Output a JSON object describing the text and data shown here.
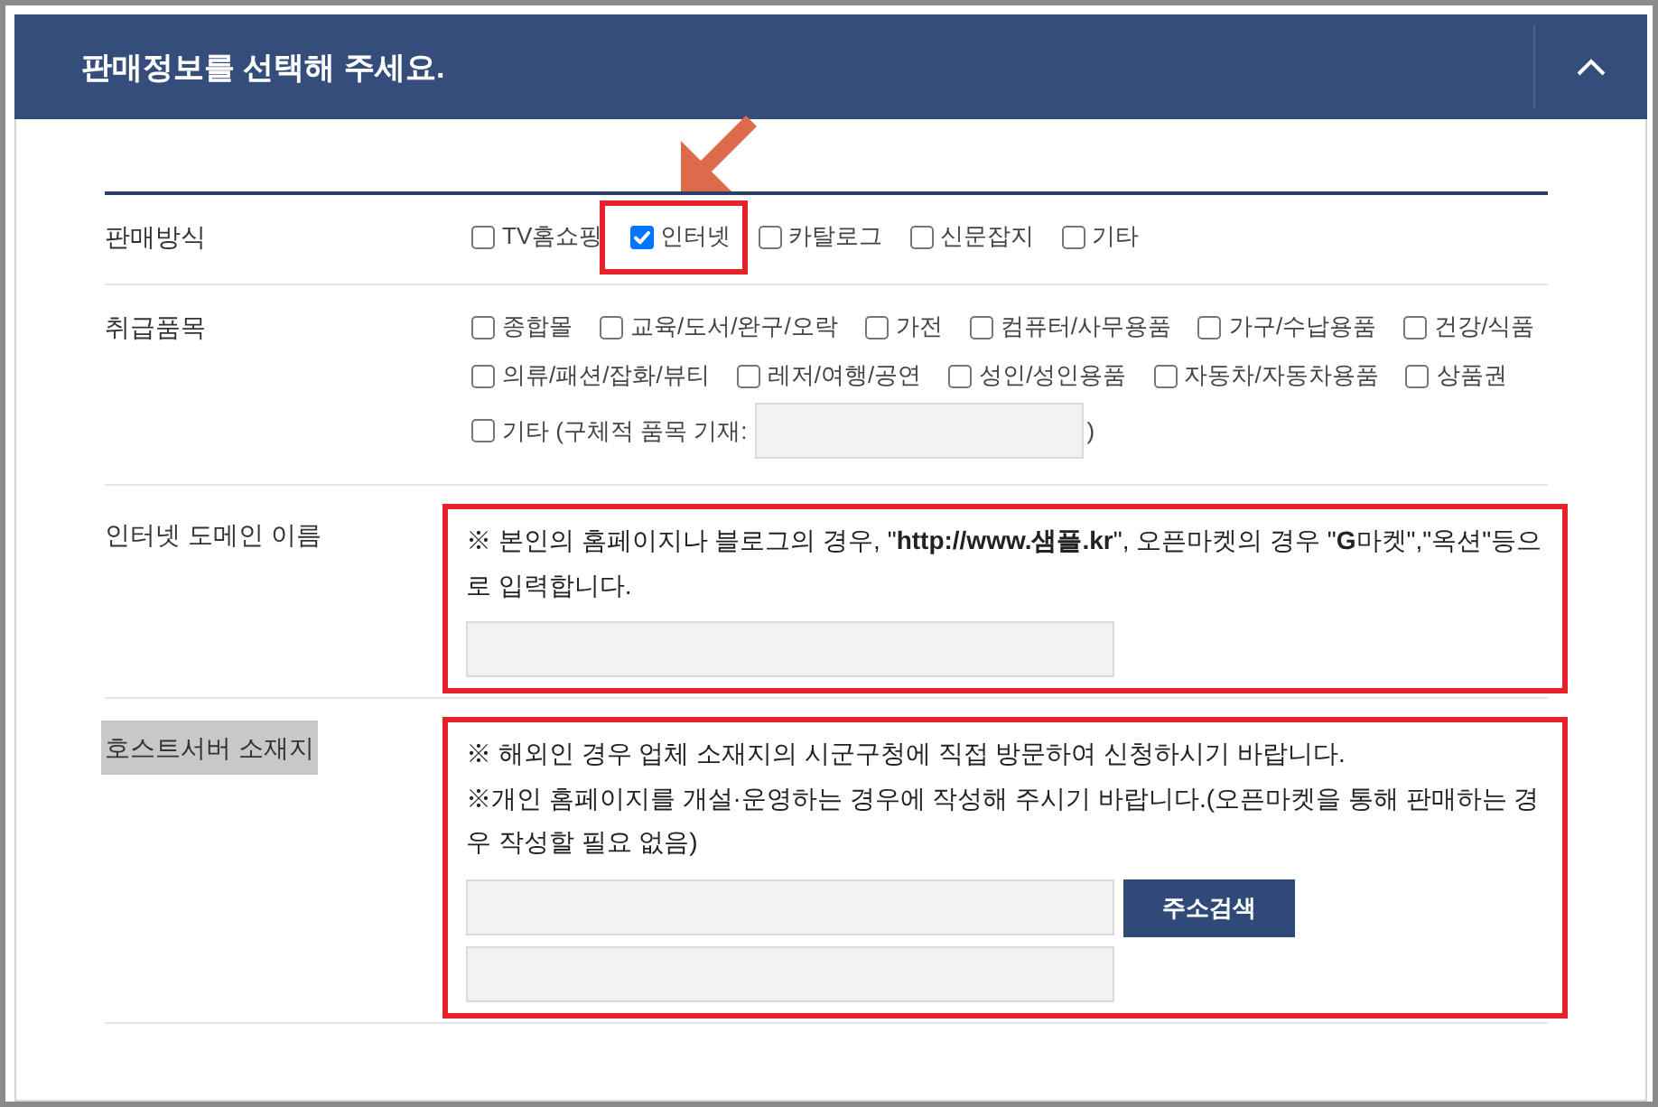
{
  "panel": {
    "title": "판매정보를 선택해 주세요.",
    "expanded": true
  },
  "rows": [
    {
      "kind": "checkboxes",
      "label": "판매방식",
      "highlighted": false,
      "framed": false,
      "options": [
        {
          "label": "TV홈쇼핑",
          "checked": false,
          "annotated": false
        },
        {
          "label": "인터넷",
          "checked": true,
          "annotated": true
        },
        {
          "label": "카탈로그",
          "checked": false,
          "annotated": false
        },
        {
          "label": "신문잡지",
          "checked": false,
          "annotated": false
        },
        {
          "label": "기타",
          "checked": false,
          "annotated": false
        }
      ]
    },
    {
      "kind": "checkboxes",
      "label": "취급품목",
      "highlighted": false,
      "framed": false,
      "options": [
        {
          "kind": "plain",
          "label": "종합몰",
          "checked": false
        },
        {
          "kind": "plain",
          "label": "교육/도서/완구/오락",
          "checked": false
        },
        {
          "kind": "plain",
          "label": "가전",
          "checked": false
        },
        {
          "kind": "plain",
          "label": "컴퓨터/사무용품",
          "checked": false
        },
        {
          "kind": "plain",
          "label": "가구/수납용품",
          "checked": false
        },
        {
          "kind": "plain",
          "label": "건강/식품",
          "checked": false
        },
        {
          "kind": "plain",
          "label": "의류/패션/잡화/뷰티",
          "checked": false
        },
        {
          "kind": "plain",
          "label": "레저/여행/공연",
          "checked": false
        },
        {
          "kind": "plain",
          "label": "성인/성인용품",
          "checked": false
        },
        {
          "kind": "plain",
          "label": "자동차/자동차용품",
          "checked": false
        },
        {
          "kind": "plain",
          "label": "상품권",
          "checked": false
        },
        {
          "kind": "with_field",
          "label": "기타 (구체적 품목 기재:",
          "suffix": ")",
          "checked": false
        }
      ]
    },
    {
      "kind": "notes",
      "label": "인터넷 도메인 이름",
      "highlighted": false,
      "framed": true,
      "notes": [
        "※ 본인의 홈페이지나 블로그의 경우, \"**http://www.샘플.kr**\", 오픈마켓의 경우 \"**G**마켓\",\"옥션\"등으로 입력합니다."
      ],
      "fields": [
        {
          "kind": "text_input"
        }
      ]
    },
    {
      "kind": "notes",
      "label": "호스트서버 소재지",
      "highlighted": true,
      "framed": true,
      "notes": [
        "※ 해외인 경우 업체 소재지의 시군구청에 직접 방문하여 신청하시기 바랍니다.",
        "※개인 홈페이지를 개설·운영하는 경우에 작성해 주시기 바랍니다.(오픈마켓을 통해 판매하는 경우 작성할 필요 없음)"
      ],
      "fields": [
        {
          "kind": "text_input_button",
          "button": "주소검색"
        },
        {
          "kind": "text_input"
        }
      ]
    }
  ]
}
